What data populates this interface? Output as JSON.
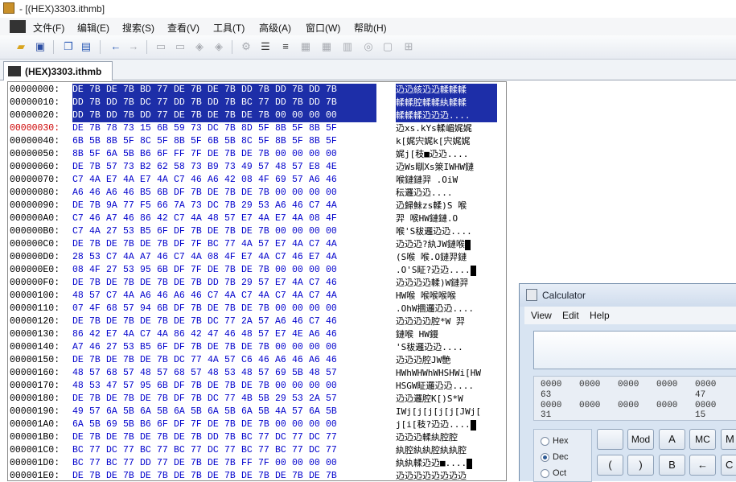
{
  "window": {
    "title": "- [(HEX)3303.ithmb]"
  },
  "menu": [
    "文件(F)",
    "编辑(E)",
    "搜索(S)",
    "查看(V)",
    "工具(T)",
    "高级(A)",
    "窗口(W)",
    "帮助(H)"
  ],
  "tab": {
    "label": "(HEX)3303.ithmb"
  },
  "hex_rows": [
    {
      "offset": "00000000:",
      "bytes": [
        "DE",
        "7B",
        "DE",
        "7B",
        "BD",
        "77",
        "DE",
        "7B",
        "DE",
        "7B",
        "DD",
        "7B",
        "DD",
        "7B",
        "DD",
        "7B"
      ],
      "ascii": "辸辸絯辸辸輮輮輮"
    },
    {
      "offset": "00000010:",
      "bytes": [
        "DD",
        "7B",
        "DD",
        "7B",
        "DC",
        "77",
        "DD",
        "7B",
        "DD",
        "7B",
        "BC",
        "77",
        "DD",
        "7B",
        "DD",
        "7B"
      ],
      "ascii": "輮輮腔輮輮紈輮輮"
    },
    {
      "offset": "00000020:",
      "bytes": [
        "DD",
        "7B",
        "DD",
        "7B",
        "DD",
        "77",
        "DE",
        "7B",
        "DE",
        "7B",
        "DE",
        "7B",
        "00",
        "00",
        "00",
        "00"
      ],
      "ascii": "輮輮輮辸辸辸...."
    },
    {
      "offset": "00000030:",
      "bytes": [
        "DE",
        "7B",
        "78",
        "73",
        "15",
        "6B",
        "59",
        "73",
        "DC",
        "7B",
        "8D",
        "5F",
        "8B",
        "5F",
        "8B",
        "5F"
      ],
      "ascii": "辸xs.kYs輮嵋娓娓",
      "red": true
    },
    {
      "offset": "00000040:",
      "bytes": [
        "6B",
        "5B",
        "8B",
        "5F",
        "8C",
        "5F",
        "8B",
        "5F",
        "6B",
        "5B",
        "8C",
        "5F",
        "8B",
        "5F",
        "8B",
        "5F"
      ],
      "ascii": "k[娓宍娓k[宍娓娓"
    },
    {
      "offset": "00000050:",
      "bytes": [
        "8B",
        "5F",
        "6A",
        "5B",
        "B6",
        "6F",
        "FF",
        "7F",
        "DE",
        "7B",
        "DE",
        "7B",
        "00",
        "00",
        "00",
        "00"
      ],
      "ascii": "娓j[秓■辸辸...."
    },
    {
      "offset": "00000060:",
      "bytes": [
        "DE",
        "7B",
        "57",
        "73",
        "B2",
        "62",
        "58",
        "73",
        "B9",
        "73",
        "49",
        "57",
        "48",
        "57",
        "E8",
        "4E"
      ],
      "ascii": "辸Ws瞓Xs箂IWHW鏈"
    },
    {
      "offset": "00000070:",
      "bytes": [
        "C7",
        "4A",
        "E7",
        "4A",
        "E7",
        "4A",
        "C7",
        "46",
        "A6",
        "42",
        "08",
        "4F",
        "69",
        "57",
        "A6",
        "46"
      ],
      "ascii": "喉鏈鏈羿 .OiW"
    },
    {
      "offset": "00000080:",
      "bytes": [
        "A6",
        "46",
        "A6",
        "46",
        "B5",
        "6B",
        "DF",
        "7B",
        "DE",
        "7B",
        "DE",
        "7B",
        "00",
        "00",
        "00",
        "00"
      ],
      "ascii": "  秐邏辸辸...."
    },
    {
      "offset": "00000090:",
      "bytes": [
        "DE",
        "7B",
        "9A",
        "77",
        "F5",
        "66",
        "7A",
        "73",
        "DC",
        "7B",
        "29",
        "53",
        "A6",
        "46",
        "C7",
        "4A"
      ],
      "ascii": "辸歸鮇zs輮)S 喉"
    },
    {
      "offset": "000000A0:",
      "bytes": [
        "C7",
        "46",
        "A7",
        "46",
        "86",
        "42",
        "C7",
        "4A",
        "48",
        "57",
        "E7",
        "4A",
        "E7",
        "4A",
        "08",
        "4F"
      ],
      "ascii": "羿 喉HW鏈鏈.O"
    },
    {
      "offset": "000000B0:",
      "bytes": [
        "C7",
        "4A",
        "27",
        "53",
        "B5",
        "6F",
        "DF",
        "7B",
        "DE",
        "7B",
        "DE",
        "7B",
        "00",
        "00",
        "00",
        "00"
      ],
      "ascii": "喉'S秡邏辸辸...."
    },
    {
      "offset": "000000C0:",
      "bytes": [
        "DE",
        "7B",
        "DE",
        "7B",
        "DE",
        "7B",
        "DF",
        "7F",
        "BC",
        "77",
        "4A",
        "57",
        "E7",
        "4A",
        "C7",
        "4A"
      ],
      "ascii": "辸辸辸?紈JW鏈喉",
      "cursor": true
    },
    {
      "offset": "000000D0:",
      "bytes": [
        "28",
        "53",
        "C7",
        "4A",
        "A7",
        "46",
        "C7",
        "4A",
        "08",
        "4F",
        "E7",
        "4A",
        "C7",
        "46",
        "E7",
        "4A"
      ],
      "ascii": "(S喉 喉.O鏈羿鏈"
    },
    {
      "offset": "000000E0:",
      "bytes": [
        "08",
        "4F",
        "27",
        "53",
        "95",
        "6B",
        "DF",
        "7F",
        "DE",
        "7B",
        "DE",
        "7B",
        "00",
        "00",
        "00",
        "00"
      ],
      "ascii": ".O'S眐?辸辸....",
      "cursor": true
    },
    {
      "offset": "000000F0:",
      "bytes": [
        "DE",
        "7B",
        "DE",
        "7B",
        "DE",
        "7B",
        "DE",
        "7B",
        "DD",
        "7B",
        "29",
        "57",
        "E7",
        "4A",
        "C7",
        "46"
      ],
      "ascii": "辸辸辸辸輮)W鏈羿"
    },
    {
      "offset": "00000100:",
      "bytes": [
        "48",
        "57",
        "C7",
        "4A",
        "A6",
        "46",
        "A6",
        "46",
        "C7",
        "4A",
        "C7",
        "4A",
        "C7",
        "4A",
        "C7",
        "4A"
      ],
      "ascii": "HW喉  喉喉喉喉"
    },
    {
      "offset": "00000110:",
      "bytes": [
        "07",
        "4F",
        "68",
        "57",
        "94",
        "6B",
        "DF",
        "7B",
        "DE",
        "7B",
        "DE",
        "7B",
        "00",
        "00",
        "00",
        "00"
      ],
      "ascii": ".OhW攌邏辸辸...."
    },
    {
      "offset": "00000120:",
      "bytes": [
        "DE",
        "7B",
        "DE",
        "7B",
        "DE",
        "7B",
        "DE",
        "7B",
        "DC",
        "77",
        "2A",
        "57",
        "A6",
        "46",
        "C7",
        "46"
      ],
      "ascii": "辸辸辸辸腔*W 羿"
    },
    {
      "offset": "00000130:",
      "bytes": [
        "86",
        "42",
        "E7",
        "4A",
        "C7",
        "4A",
        "86",
        "42",
        "47",
        "46",
        "48",
        "57",
        "E7",
        "4E",
        "A6",
        "46"
      ],
      "ascii": "鏈喉 HW鏝 "
    },
    {
      "offset": "00000140:",
      "bytes": [
        "A7",
        "46",
        "27",
        "53",
        "B5",
        "6F",
        "DF",
        "7B",
        "DE",
        "7B",
        "DE",
        "7B",
        "00",
        "00",
        "00",
        "00"
      ],
      "ascii": " 'S秡邏辸辸...."
    },
    {
      "offset": "00000150:",
      "bytes": [
        "DE",
        "7B",
        "DE",
        "7B",
        "DE",
        "7B",
        "DC",
        "77",
        "4A",
        "57",
        "C6",
        "46",
        "A6",
        "46",
        "A6",
        "46"
      ],
      "ascii": "辸辸辸腔JW艶  "
    },
    {
      "offset": "00000160:",
      "bytes": [
        "48",
        "57",
        "68",
        "57",
        "48",
        "57",
        "68",
        "57",
        "48",
        "53",
        "48",
        "57",
        "69",
        "5B",
        "48",
        "57"
      ],
      "ascii": "HWhWHWhWHSHWi[HW"
    },
    {
      "offset": "00000170:",
      "bytes": [
        "48",
        "53",
        "47",
        "57",
        "95",
        "6B",
        "DF",
        "7B",
        "DE",
        "7B",
        "DE",
        "7B",
        "00",
        "00",
        "00",
        "00"
      ],
      "ascii": "HSGW眐邏辸辸...."
    },
    {
      "offset": "00000180:",
      "bytes": [
        "DE",
        "7B",
        "DE",
        "7B",
        "DE",
        "7B",
        "DF",
        "7B",
        "DC",
        "77",
        "4B",
        "5B",
        "29",
        "53",
        "2A",
        "57"
      ],
      "ascii": "辸辸邏腔K[)S*W"
    },
    {
      "offset": "00000190:",
      "bytes": [
        "49",
        "57",
        "6A",
        "5B",
        "6A",
        "5B",
        "6A",
        "5B",
        "6A",
        "5B",
        "6A",
        "5B",
        "4A",
        "57",
        "6A",
        "5B"
      ],
      "ascii": "IWj[j[j[j[j[JWj["
    },
    {
      "offset": "000001A0:",
      "bytes": [
        "6A",
        "5B",
        "69",
        "5B",
        "B6",
        "6F",
        "DF",
        "7F",
        "DE",
        "7B",
        "DE",
        "7B",
        "00",
        "00",
        "00",
        "00"
      ],
      "ascii": "j[i[秓?辸辸....",
      "cursor": true
    },
    {
      "offset": "000001B0:",
      "bytes": [
        "DE",
        "7B",
        "DE",
        "7B",
        "DE",
        "7B",
        "DE",
        "7B",
        "DD",
        "7B",
        "BC",
        "77",
        "DC",
        "77",
        "DC",
        "77"
      ],
      "ascii": "辸辸辸輮紈腔腔"
    },
    {
      "offset": "000001C0:",
      "bytes": [
        "BC",
        "77",
        "DC",
        "77",
        "BC",
        "77",
        "BC",
        "77",
        "DC",
        "77",
        "BC",
        "77",
        "BC",
        "77",
        "DC",
        "77"
      ],
      "ascii": "紈腔紈紈腔紈紈腔"
    },
    {
      "offset": "000001D0:",
      "bytes": [
        "BC",
        "77",
        "BC",
        "77",
        "DD",
        "77",
        "DE",
        "7B",
        "DE",
        "7B",
        "FF",
        "7F",
        "00",
        "00",
        "00",
        "00"
      ],
      "ascii": "紈紈輮辸辸■....",
      "cursor": true
    },
    {
      "offset": "000001E0:",
      "bytes": [
        "DE",
        "7B",
        "DE",
        "7B",
        "DE",
        "7B",
        "DE",
        "7B",
        "DE",
        "7B",
        "DE",
        "7B",
        "DE",
        "7B",
        "DE",
        "7B"
      ],
      "ascii": "辸辸辸辸辸辸辸辸"
    }
  ],
  "calculator": {
    "title": "Calculator",
    "menu": [
      "View",
      "Edit",
      "Help"
    ],
    "bits_row1": [
      "0000",
      "0000",
      "0000",
      "0000",
      "0000"
    ],
    "bits_row1_labels": [
      "63",
      "47"
    ],
    "bits_row2": [
      "0000",
      "0000",
      "0000",
      "0000",
      "0000"
    ],
    "bits_row2_labels": [
      "31",
      "15"
    ],
    "radios": [
      {
        "label": "Hex",
        "checked": false
      },
      {
        "label": "Dec",
        "checked": true
      },
      {
        "label": "Oct",
        "checked": false
      }
    ],
    "buttons_row1": [
      "",
      "Mod",
      "A",
      "MC",
      "M"
    ],
    "buttons_row2": [
      "(",
      ")",
      "B",
      "←",
      "C"
    ]
  }
}
